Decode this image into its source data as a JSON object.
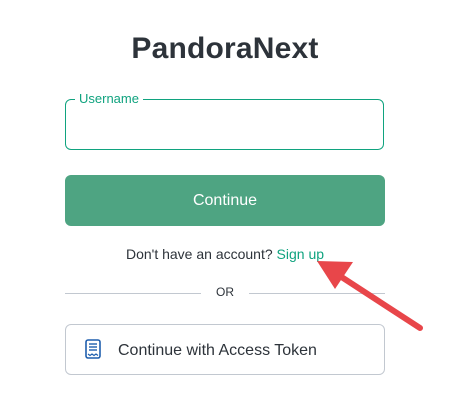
{
  "app": {
    "title": "PandoraNext"
  },
  "login_form": {
    "username_label": "Username",
    "username_value": "",
    "continue_label": "Continue",
    "signup_prompt": "Don't have an account?",
    "signup_link": "Sign up",
    "divider_text": "OR",
    "access_token_label": "Continue with Access Token"
  },
  "icons": {
    "access_token": "receipt-icon",
    "annotation": "red-arrow-icon"
  },
  "colors": {
    "accent": "#10a37f",
    "primary_button": "#4ea482",
    "text": "#2d333a",
    "border": "#c2c8d0",
    "annotation_arrow": "#e8464a"
  }
}
